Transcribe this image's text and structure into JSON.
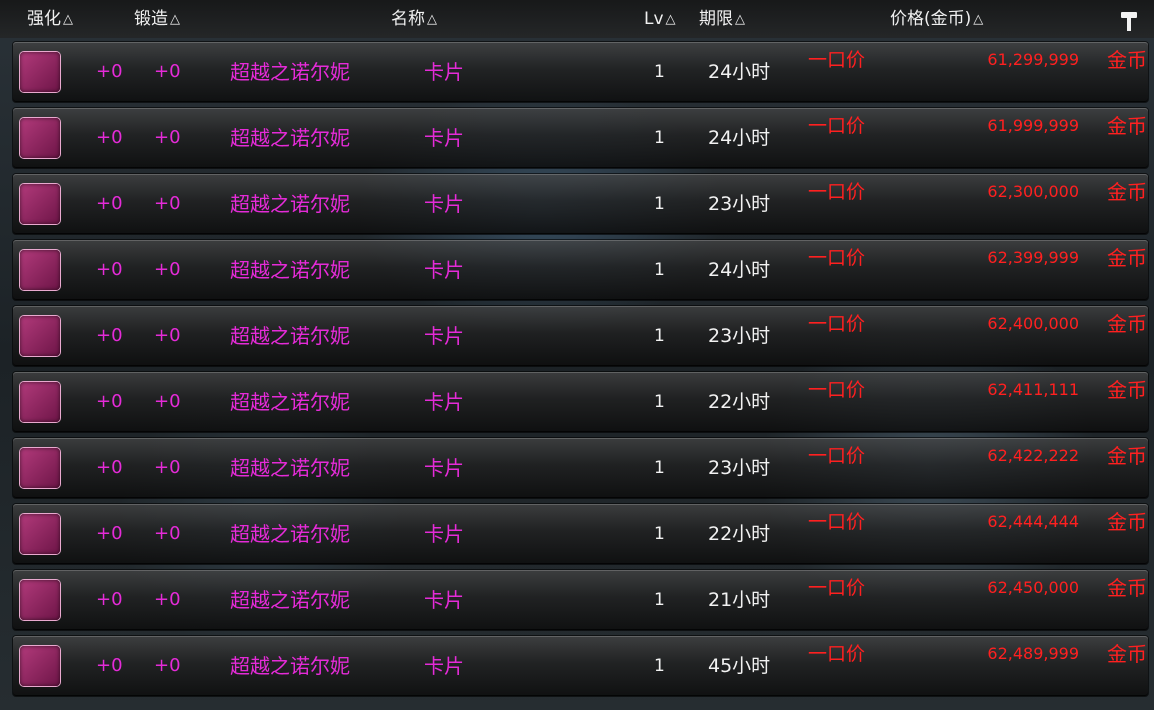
{
  "header": {
    "columns": [
      {
        "key": "strengthen",
        "label": "强化"
      },
      {
        "key": "forge",
        "label": "锻造"
      },
      {
        "key": "name",
        "label": "名称"
      },
      {
        "key": "level",
        "label": "Lv"
      },
      {
        "key": "period",
        "label": "期限"
      },
      {
        "key": "price",
        "label": "价格(金币)"
      }
    ],
    "sort_glyph": "△",
    "hammer_icon": "hammer-icon"
  },
  "listings": [
    {
      "strengthen": "+0",
      "forge": "+0",
      "name": "超越之诺尔妮",
      "type": "卡片",
      "level": "1",
      "period": "24小时",
      "buyout": "一口价",
      "price": "61,299,999",
      "currency": "金币"
    },
    {
      "strengthen": "+0",
      "forge": "+0",
      "name": "超越之诺尔妮",
      "type": "卡片",
      "level": "1",
      "period": "24小时",
      "buyout": "一口价",
      "price": "61,999,999",
      "currency": "金币"
    },
    {
      "strengthen": "+0",
      "forge": "+0",
      "name": "超越之诺尔妮",
      "type": "卡片",
      "level": "1",
      "period": "23小时",
      "buyout": "一口价",
      "price": "62,300,000",
      "currency": "金币"
    },
    {
      "strengthen": "+0",
      "forge": "+0",
      "name": "超越之诺尔妮",
      "type": "卡片",
      "level": "1",
      "period": "24小时",
      "buyout": "一口价",
      "price": "62,399,999",
      "currency": "金币"
    },
    {
      "strengthen": "+0",
      "forge": "+0",
      "name": "超越之诺尔妮",
      "type": "卡片",
      "level": "1",
      "period": "23小时",
      "buyout": "一口价",
      "price": "62,400,000",
      "currency": "金币"
    },
    {
      "strengthen": "+0",
      "forge": "+0",
      "name": "超越之诺尔妮",
      "type": "卡片",
      "level": "1",
      "period": "22小时",
      "buyout": "一口价",
      "price": "62,411,111",
      "currency": "金币"
    },
    {
      "strengthen": "+0",
      "forge": "+0",
      "name": "超越之诺尔妮",
      "type": "卡片",
      "level": "1",
      "period": "23小时",
      "buyout": "一口价",
      "price": "62,422,222",
      "currency": "金币"
    },
    {
      "strengthen": "+0",
      "forge": "+0",
      "name": "超越之诺尔妮",
      "type": "卡片",
      "level": "1",
      "period": "22小时",
      "buyout": "一口价",
      "price": "62,444,444",
      "currency": "金币"
    },
    {
      "strengthen": "+0",
      "forge": "+0",
      "name": "超越之诺尔妮",
      "type": "卡片",
      "level": "1",
      "period": "21小时",
      "buyout": "一口价",
      "price": "62,450,000",
      "currency": "金币"
    },
    {
      "strengthen": "+0",
      "forge": "+0",
      "name": "超越之诺尔妮",
      "type": "卡片",
      "level": "1",
      "period": "45小时",
      "buyout": "一口价",
      "price": "62,489,999",
      "currency": "金币"
    }
  ],
  "item_icon": "card-icon",
  "colors": {
    "enhance_text": "#e52bd8",
    "price_text": "#ff2020",
    "level_text": "#f2f2f2"
  }
}
